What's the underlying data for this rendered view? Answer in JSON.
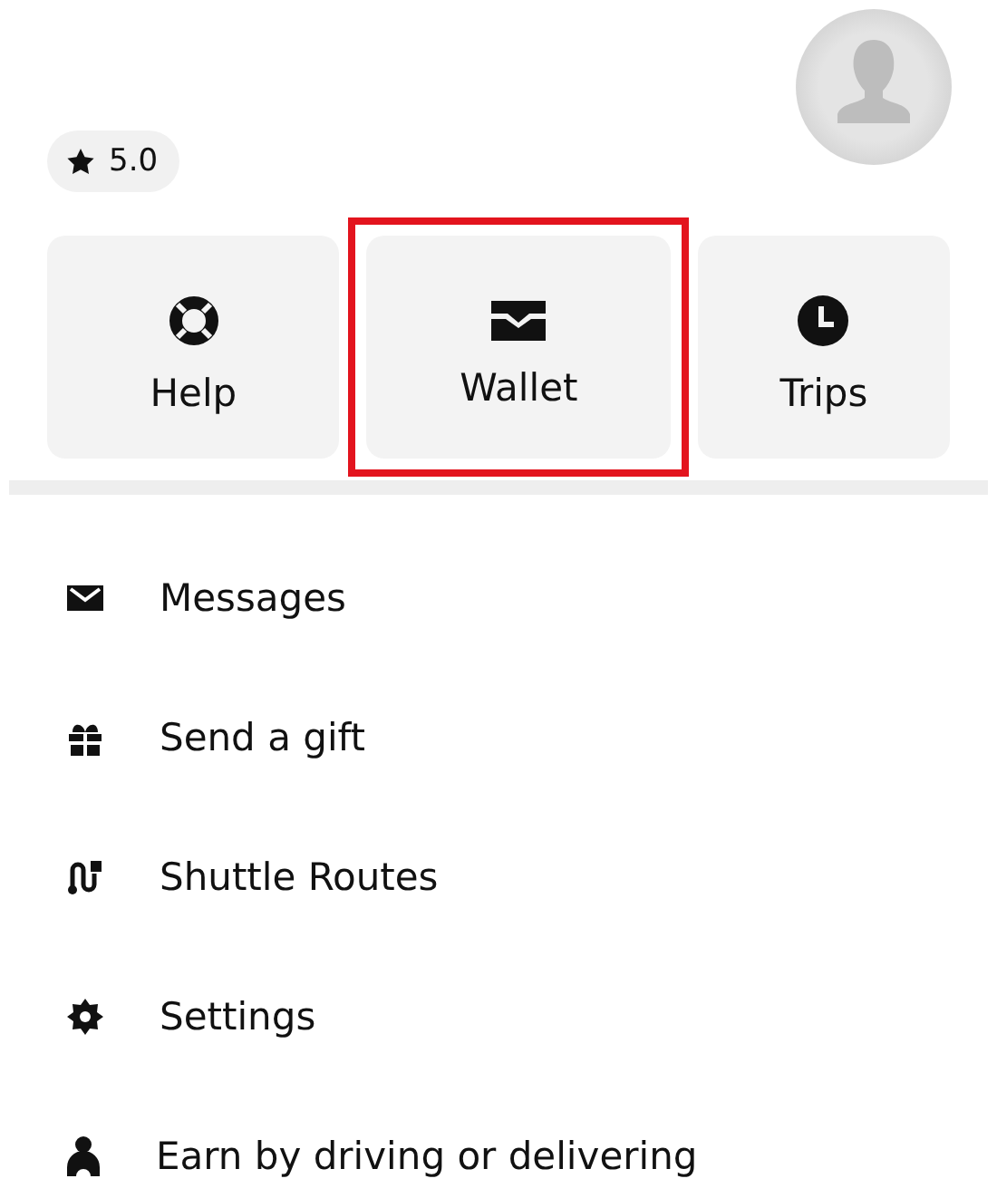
{
  "profile": {
    "rating": "5.0"
  },
  "tiles": [
    {
      "label": "Help",
      "highlighted": false
    },
    {
      "label": "Wallet",
      "highlighted": true
    },
    {
      "label": "Trips",
      "highlighted": false
    }
  ],
  "menu": [
    {
      "label": "Messages"
    },
    {
      "label": "Send a gift"
    },
    {
      "label": "Shuttle Routes"
    },
    {
      "label": "Settings"
    },
    {
      "label": "Earn by driving or delivering"
    }
  ]
}
